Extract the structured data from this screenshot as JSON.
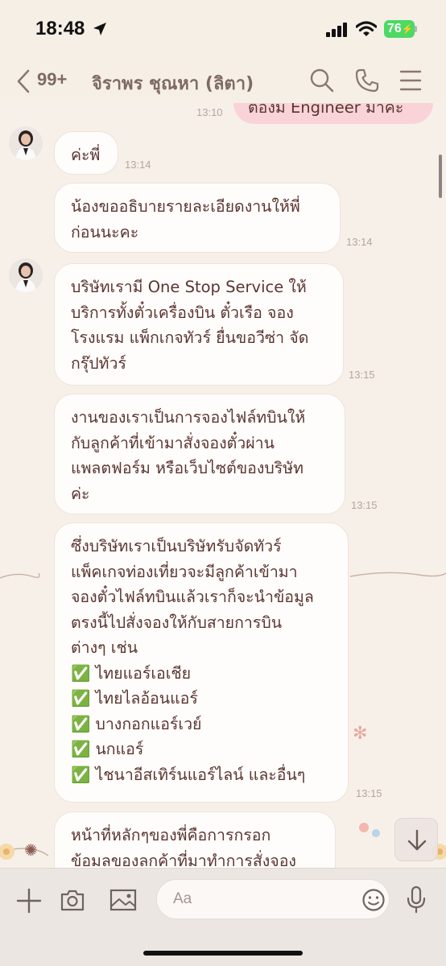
{
  "status_bar": {
    "time": "18:48",
    "battery": "76"
  },
  "header": {
    "back_count": "99+",
    "title": "จิราพร ชุณหา (ลิตา)"
  },
  "outgoing_partial": {
    "text": "ต้องมี Engineer มาค่ะ",
    "time": "13:10"
  },
  "messages": [
    {
      "lines": [
        "ค่ะพี่"
      ],
      "time": "13:14"
    },
    {
      "lines": [
        "น้องขออธิบายรายละเอียดงานให้พี่",
        "ก่อนนะคะ"
      ],
      "time": "13:14"
    },
    {
      "lines": [
        "บริษัทเรามี One Stop Service ให้",
        "บริการทั้งตั๋วเครื่องบิน ตั๋วเรือ  จอง",
        "โรงแรม แพ็กเกจทัวร์ ยื่นขอวีซ่า จัด",
        "กรุ๊ปทัวร์"
      ],
      "time": "13:15"
    },
    {
      "lines": [
        "งานของเราเป็นการจองไฟล์ทบินให้",
        "กับลูกค้าที่เข้ามาสั่งจองตั๋วผ่าน",
        "แพลตฟอร์ม หรือเว็บไซต์ของบริษัท",
        "ค่ะ"
      ],
      "time": "13:15"
    },
    {
      "lines": [
        "ซึ่งบริษัทเราเป็นบริษัทรับจัดทัวร์",
        "แพ็คเกจท่องเที่ยวจะมีลูกค้าเข้ามา",
        "จองตั๋วไฟล์ทบินแล้วเราก็จะนำข้อมูล",
        "ตรงนี้ไปสั่งจองให้กับสายการบิน",
        "ต่างๆ เช่น",
        "✅ ไทยแอร์เอเชีย",
        "✅ ไทยไลอ้อนแอร์",
        "✅ บางกอกแอร์เวย์",
        "✅ นกแอร์",
        "✅ ไชนาอีสเทิร์นแอร์ไลน์ และอื่นๆ"
      ],
      "time": "13:15"
    },
    {
      "lines": [
        "หน้าที่หลักๆของพี่คือการกรอก",
        "ข้อมลของลกค้าที่มาทำการสั่งจอง"
      ],
      "time": ""
    }
  ],
  "input": {
    "placeholder": "Aa"
  },
  "icons": [
    "location-arrow-icon",
    "signal-icon",
    "wifi-icon",
    "back-chevron-icon",
    "search-icon",
    "phone-icon",
    "menu-icon",
    "plus-icon",
    "camera-icon",
    "image-icon",
    "emoji-icon",
    "microphone-icon",
    "arrow-down-icon"
  ],
  "colors": {
    "background": "#f6efe6",
    "bubble": "#fffdfb",
    "outgoing_bubble": "#f9d3d8",
    "text": "#5a3530",
    "battery": "#4cd964"
  }
}
